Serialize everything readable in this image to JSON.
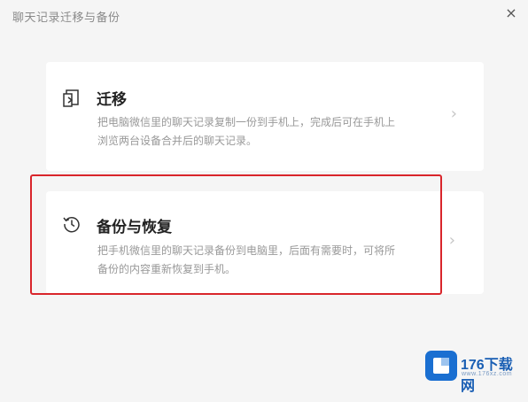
{
  "window": {
    "title": "聊天记录迁移与备份",
    "close_glyph": "×"
  },
  "options": [
    {
      "id": "migrate",
      "icon": "migrate-icon",
      "title": "迁移",
      "description": "把电脑微信里的聊天记录复制一份到手机上，完成后可在手机上浏览两台设备合并后的聊天记录。",
      "chevron": "›"
    },
    {
      "id": "backup",
      "icon": "history-clock-icon",
      "title": "备份与恢复",
      "description": "把手机微信里的聊天记录备份到电脑里，后面有需要时，可将所备份的内容重新恢复到手机。",
      "chevron": "›"
    }
  ],
  "annotation": {
    "highlight_color": "#d9252b"
  },
  "watermark": {
    "brand": "176下载网",
    "url": "www.176xz.com"
  },
  "colors": {
    "background": "#f5f5f5",
    "card": "#ffffff",
    "title_text": "#222222",
    "desc_text": "#999999",
    "brand_blue": "#1a6fd1"
  }
}
